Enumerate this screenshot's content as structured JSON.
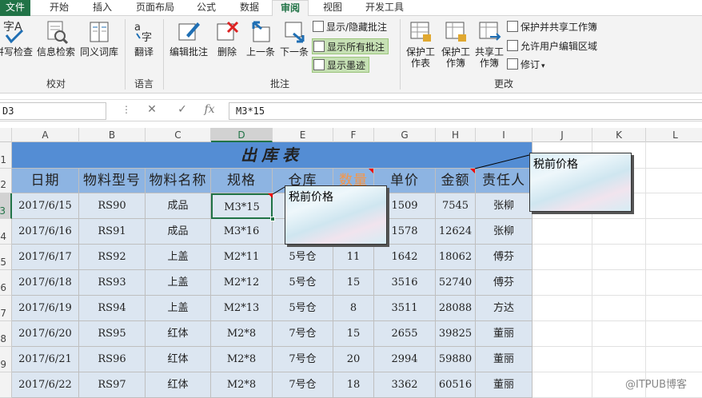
{
  "tabs": [
    "文件",
    "开始",
    "插入",
    "页面布局",
    "公式",
    "数据",
    "审阅",
    "视图",
    "开发工具"
  ],
  "ribbon": {
    "proof": {
      "spell": "拼写检查",
      "research": "信息检索",
      "thesaurus": "同义词库",
      "group": "校对"
    },
    "lang": {
      "translate": "翻译",
      "group": "语言"
    },
    "comments": {
      "edit": "编辑批注",
      "delete": "删除",
      "prev": "上一条",
      "next": "下一条",
      "showhide": "显示/隐藏批注",
      "showall": "显示所有批注",
      "showink": "显示墨迹",
      "group": "批注"
    },
    "changes": {
      "protect_sheet": "保护工作表",
      "protect_book": "保护工作簿",
      "share_book": "共享工作簿",
      "protect_share": "保护并共享工作簿",
      "allow_edit": "允许用户编辑区域",
      "track": "修订",
      "group": "更改"
    }
  },
  "formula_bar": {
    "name_box": "D3",
    "fx": "fx",
    "value": "M3*15",
    "cancel": "✕",
    "enter": "✓"
  },
  "columns": [
    "A",
    "B",
    "C",
    "D",
    "E",
    "F",
    "G",
    "H",
    "I",
    "J",
    "K",
    "L"
  ],
  "rows": [
    "1",
    "2",
    "3",
    "4",
    "5",
    "6",
    "7",
    "8",
    "9"
  ],
  "sheet": {
    "title": "出库表",
    "headers": [
      "日期",
      "物料型号",
      "物料名称",
      "规格",
      "仓库",
      "数量",
      "单价",
      "金额",
      "责任人"
    ],
    "data": [
      [
        "2017/6/15",
        "RS90",
        "成品",
        "M3*15",
        "",
        "",
        "1509",
        "7545",
        "张柳"
      ],
      [
        "2017/6/16",
        "RS91",
        "成品",
        "M3*16",
        "",
        "",
        "1578",
        "12624",
        "张柳"
      ],
      [
        "2017/6/17",
        "RS92",
        "上盖",
        "M2*11",
        "5号仓",
        "11",
        "1642",
        "18062",
        "傅芬"
      ],
      [
        "2017/6/18",
        "RS93",
        "上盖",
        "M2*12",
        "5号仓",
        "15",
        "3516",
        "52740",
        "傅芬"
      ],
      [
        "2017/6/19",
        "RS94",
        "上盖",
        "M2*13",
        "5号仓",
        "8",
        "3511",
        "28088",
        "方达"
      ],
      [
        "2017/6/20",
        "RS95",
        "红体",
        "M2*8",
        "7号仓",
        "15",
        "2655",
        "39825",
        "董丽"
      ],
      [
        "2017/6/21",
        "RS96",
        "红体",
        "M2*8",
        "7号仓",
        "20",
        "2994",
        "59880",
        "董丽"
      ],
      [
        "2017/6/22",
        "RS97",
        "红体",
        "M2*8",
        "7号仓",
        "18",
        "3362",
        "60516",
        "董丽"
      ]
    ]
  },
  "comments": [
    {
      "text": "税前价格"
    },
    {
      "text": "税前价格"
    }
  ],
  "watermark": "@ITPUB博客",
  "colors": {
    "file_tab": "#217346",
    "title_fill": "#548dd4",
    "header_fill": "#8db4e2",
    "data_fill": "#dce6f1",
    "highlight_header": "#f79646"
  }
}
